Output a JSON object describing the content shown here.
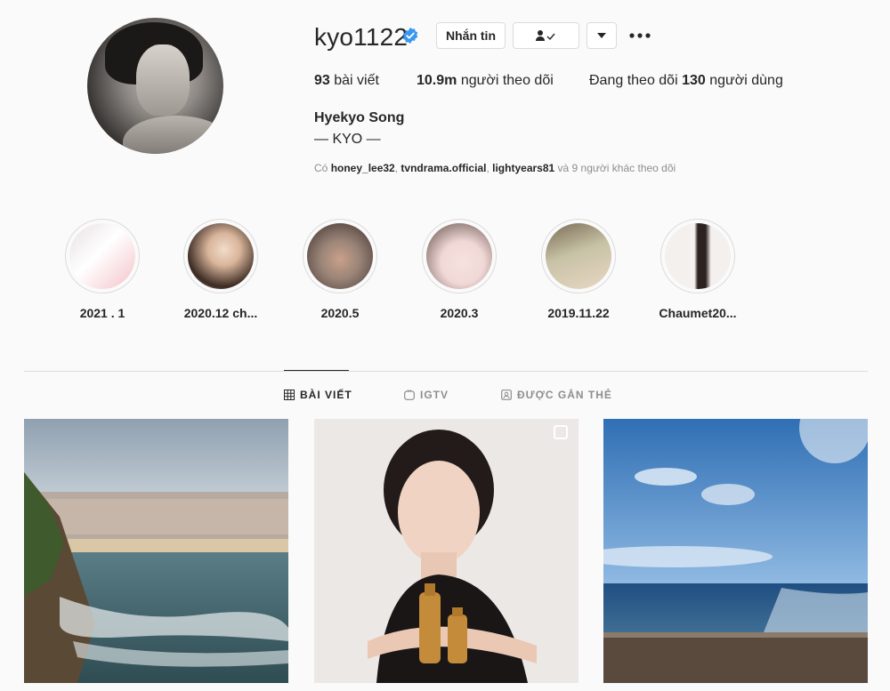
{
  "profile": {
    "username": "kyo1122",
    "full_name": "Hyekyo Song",
    "bio": "— KYO —"
  },
  "buttons": {
    "message_label": "Nhắn tin",
    "following_icon": "person-check-icon",
    "caret_icon": "caret-down-icon",
    "more_icon": "more-dots-icon"
  },
  "stats": {
    "posts_count": "93",
    "posts_label": "bài viết",
    "followers_count": "10.9m",
    "followers_label": "người theo dõi",
    "following_prefix": "Đang theo dõi",
    "following_count": "130",
    "following_label": "người dùng"
  },
  "followed_by": {
    "prefix": "Có",
    "users": [
      "honey_lee32",
      "tvndrama.official",
      "lightyears81"
    ],
    "suffix": "và 9 người khác theo dõi"
  },
  "highlights": [
    {
      "label": "2021 . 1",
      "colors": [
        "#e8e0e2",
        "#f3c2c8"
      ]
    },
    {
      "label": "2020.12 ch...",
      "colors": [
        "#e7dccf",
        "#3a2a22"
      ]
    },
    {
      "label": "2020.5",
      "colors": [
        "#9a8478",
        "#3b2e29"
      ]
    },
    {
      "label": "2020.3",
      "colors": [
        "#f0d8d6",
        "#5a4640"
      ]
    },
    {
      "label": "2019.11.22",
      "colors": [
        "#c7c2a6",
        "#7a6c55"
      ]
    },
    {
      "label": "Chaumet20...",
      "colors": [
        "#f4f0ee",
        "#2c2220"
      ]
    }
  ],
  "tabs": [
    {
      "label": "BÀI VIẾT",
      "icon": "grid-icon",
      "active": true
    },
    {
      "label": "IGTV",
      "icon": "igtv-icon",
      "active": false
    },
    {
      "label": "ĐƯỢC GẮN THẺ",
      "icon": "tagged-icon",
      "active": false
    }
  ],
  "accent_color": "#3897f0",
  "text_color": "#262626",
  "muted_color": "#8e8e8e"
}
